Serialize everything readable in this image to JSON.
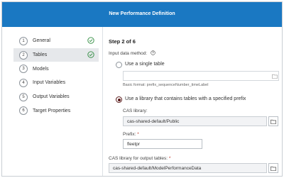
{
  "dialog": {
    "title": "New Performance Definition"
  },
  "sidebar": {
    "steps": [
      {
        "num": "1",
        "label": "General",
        "completed": true,
        "selected": false
      },
      {
        "num": "2",
        "label": "Tables",
        "completed": true,
        "selected": true
      },
      {
        "num": "3",
        "label": "Models",
        "completed": false,
        "selected": false
      },
      {
        "num": "4",
        "label": "Input Variables",
        "completed": false,
        "selected": false
      },
      {
        "num": "5",
        "label": "Output Variables",
        "completed": false,
        "selected": false
      },
      {
        "num": "6",
        "label": "Target Properties",
        "completed": false,
        "selected": false
      }
    ]
  },
  "main": {
    "step_title": "Step 2 of 6",
    "input_method_label": "Input data method:",
    "single_table": {
      "label": "Use a single table",
      "selected": false,
      "value": "",
      "hint": "Basic format: prefix_sequenceNumber_timeLabel"
    },
    "library_option": {
      "label": "Use a library that contains tables with a specified prefix",
      "selected": true
    },
    "cas_library": {
      "label": "CAS library:",
      "value": "cas-shared-default/Public"
    },
    "prefix": {
      "label": "Prefix:",
      "required_marker": "*",
      "value": "fleetpr"
    },
    "output_library": {
      "label": "CAS library for output tables:",
      "required_marker": "*",
      "value": "cas-shared-default/ModelPerformanceData"
    }
  },
  "colors": {
    "header_blue": "#1a78c2",
    "check_green": "#2e8b3e",
    "radio_selected": "#5a1a1a",
    "required_red": "#c0392b"
  },
  "icons": {
    "completed": "check-circle-icon",
    "help": "help-circle-icon",
    "browse": "folder-icon"
  }
}
